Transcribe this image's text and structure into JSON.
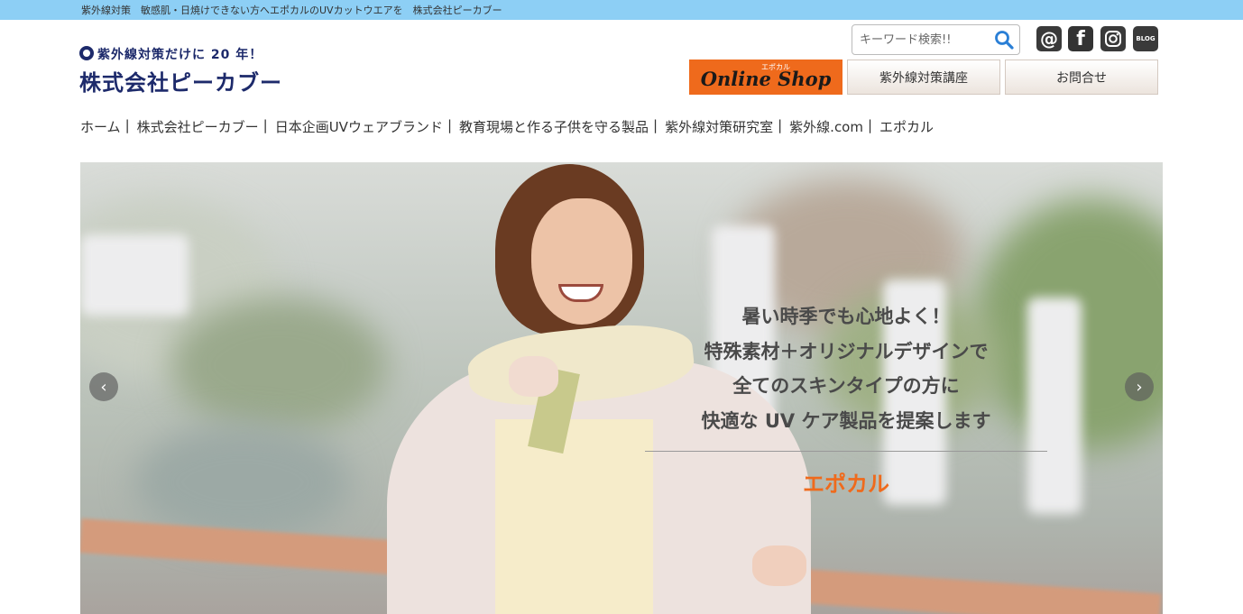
{
  "topbar": {
    "text": "紫外線対策　敏感肌・日焼けできない方へエポカルのUVカットウエアを　株式会社ピーカブー"
  },
  "logo": {
    "tagline": "紫外線対策だけに 20 年！",
    "name": "株式会社ピーカブー"
  },
  "search": {
    "placeholder": "キーワード検索!!",
    "icon": "search-icon"
  },
  "social": [
    {
      "icon": "mail-icon",
      "glyph": "@"
    },
    {
      "icon": "facebook-icon",
      "glyph": "f"
    },
    {
      "icon": "instagram-icon",
      "glyph": ""
    },
    {
      "icon": "blog-icon",
      "glyph": "BLOG"
    }
  ],
  "buttons": {
    "shop_sub": "エポカル",
    "shop_label": "Online Shop",
    "uv_course": "紫外線対策講座",
    "contact": "お問合せ"
  },
  "nav": [
    "ホーム",
    "株式会社ピーカブー",
    "日本企画UVウェアブランド",
    "教育現場と作る子供を守る製品",
    "紫外線対策研究室",
    "紫外線.com",
    "エポカル"
  ],
  "nav_separator": "|",
  "hero": {
    "lines": [
      "暑い時季でも心地よく！",
      "特殊素材＋オリジナルデザインで",
      "全てのスキンタイプの方に",
      "快適な UV ケア製品を提案します"
    ],
    "brand": "エポカル",
    "prev_glyph": "‹",
    "next_glyph": "›"
  },
  "colors": {
    "topbar": "#8dcff5",
    "accent": "#ef6a1c",
    "logo": "#1d2a6b"
  }
}
